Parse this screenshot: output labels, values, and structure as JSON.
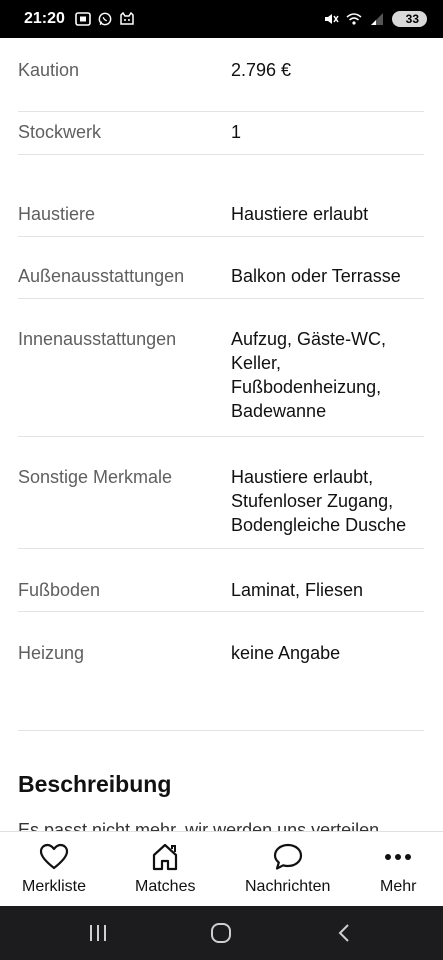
{
  "status_bar": {
    "time": "21:20",
    "battery_level": "33",
    "left_icons": [
      "screenshot-icon",
      "whatsapp-icon",
      "cat-icon"
    ],
    "right_icons": [
      "mute-icon",
      "wifi-icon",
      "signal-icon"
    ]
  },
  "details": [
    {
      "label": "Kaution",
      "value": "2.796 €"
    },
    {
      "label": "Stockwerk",
      "value": "1"
    },
    {
      "label": "Haustiere",
      "value": "Haustiere erlaubt"
    },
    {
      "label": "Außenausstattungen",
      "value": "Balkon oder Terrasse"
    },
    {
      "label": "Innenausstattungen",
      "value": "Aufzug, Gäste-WC,\nKeller,\nFußbodenheizung,\nBadewanne"
    },
    {
      "label": "Sonstige Merkmale",
      "value": "Haustiere erlaubt,\nStufenloser Zugang,\nBodengleiche Dusche"
    },
    {
      "label": "Fußboden",
      "value": "Laminat, Fliesen"
    },
    {
      "label": "Heizung",
      "value": "keine Angabe"
    }
  ],
  "description": {
    "title": "Beschreibung",
    "teaser": "Es passt nicht mehr, wir werden uns verteilen"
  },
  "bottom_nav": {
    "items": [
      {
        "label": "Merkliste",
        "icon": "heart-icon"
      },
      {
        "label": "Matches",
        "icon": "home-icon"
      },
      {
        "label": "Nachrichten",
        "icon": "chat-bubble-icon"
      },
      {
        "label": "Mehr",
        "icon": "more-dots-icon"
      }
    ]
  },
  "system_nav": {
    "buttons": [
      "recent-apps-icon",
      "home-circle-icon",
      "back-icon"
    ]
  }
}
